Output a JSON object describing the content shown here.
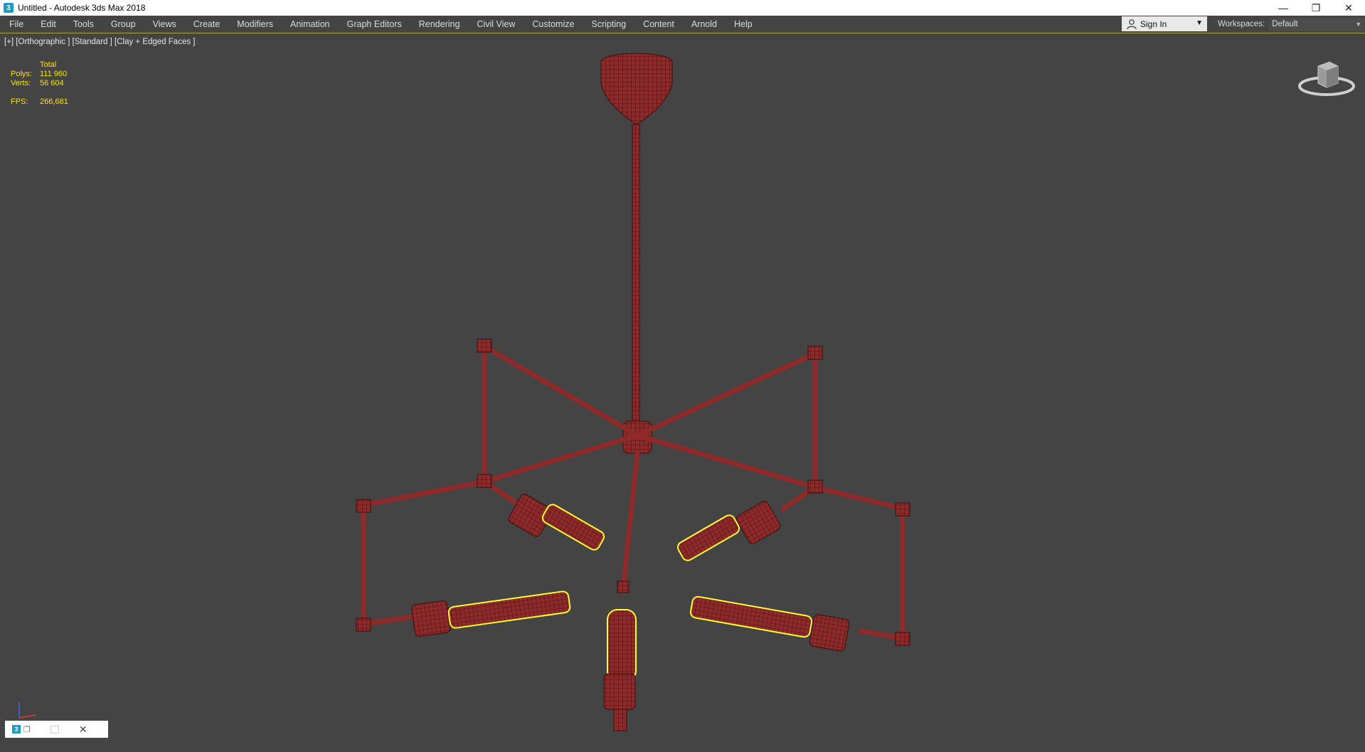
{
  "window": {
    "title": "Untitled - Autodesk 3ds Max 2018",
    "app_icon": "3",
    "controls": {
      "minimize": "—",
      "restore": "❐",
      "close": "✕"
    }
  },
  "menu": {
    "items": [
      "File",
      "Edit",
      "Tools",
      "Group",
      "Views",
      "Create",
      "Modifiers",
      "Animation",
      "Graph Editors",
      "Rendering",
      "Civil View",
      "Customize",
      "Scripting",
      "Content",
      "Arnold",
      "Help"
    ],
    "sign_in": "Sign In",
    "workspaces_label": "Workspaces:",
    "workspace_value": "Default",
    "accent_color": "#b9a24a"
  },
  "viewport": {
    "label": "[+] [Orthographic ] [Standard ] [Clay + Edged Faces ]",
    "background": "#444444",
    "stats": {
      "total_label": "Total",
      "polys_label": "Polys:",
      "polys_value": "111 960",
      "verts_label": "Verts:",
      "verts_value": "56 604",
      "fps_label": "FPS:",
      "fps_value": "266,681",
      "color": "#ffe500"
    },
    "model": {
      "name": "chandelier",
      "mesh_color": "#8e2a2a",
      "wire_color": "#3a0d0d",
      "selection_color": "#ffff33"
    }
  },
  "minibar": {
    "app_icon": "3",
    "close": "✕"
  }
}
